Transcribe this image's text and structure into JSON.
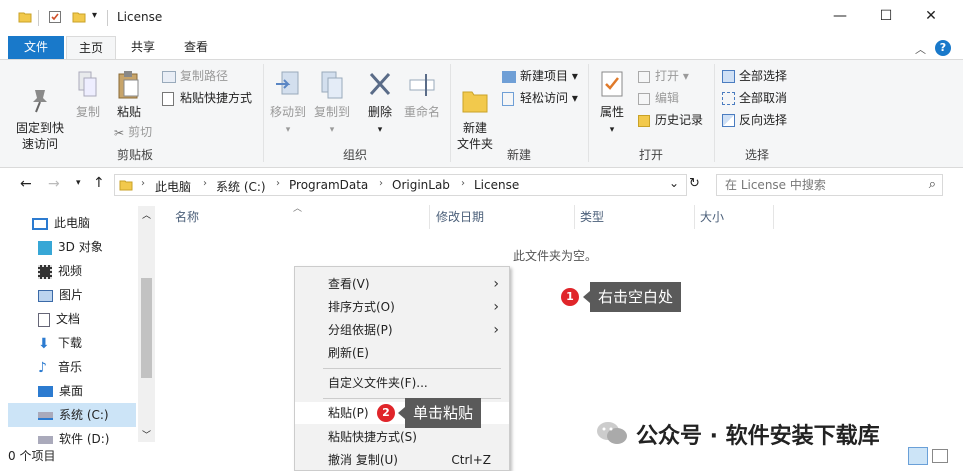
{
  "window": {
    "title": "License",
    "min": "—",
    "max": "☐",
    "close": "✕"
  },
  "tabs": {
    "file": "文件",
    "home": "主页",
    "share": "共享",
    "view": "查看"
  },
  "ribbon": {
    "pin": "固定到快\n速访问",
    "copy": "复制",
    "paste": "粘贴",
    "copy_path": "复制路径",
    "paste_shortcut": "粘贴快捷方式",
    "cut": "剪切",
    "clipboard_group": "剪贴板",
    "move_to": "移动到",
    "copy_to": "复制到",
    "delete": "删除",
    "rename": "重命名",
    "organize_group": "组织",
    "new_folder": "新建\n文件夹",
    "new_item": "新建项目",
    "easy_access": "轻松访问",
    "new_group": "新建",
    "properties": "属性",
    "open": "打开",
    "edit": "编辑",
    "history": "历史记录",
    "open_group": "打开",
    "select_all": "全部选择",
    "select_none": "全部取消",
    "invert_selection": "反向选择",
    "select_group": "选择"
  },
  "address": {
    "crumbs": [
      "此电脑",
      "系统 (C:)",
      "ProgramData",
      "OriginLab",
      "License"
    ],
    "search_placeholder": "在 License 中搜索"
  },
  "nav_pane": {
    "items": [
      "此电脑",
      "3D 对象",
      "视频",
      "图片",
      "文档",
      "下载",
      "音乐",
      "桌面",
      "系统 (C:)",
      "软件 (D:)"
    ]
  },
  "columns": {
    "name": "名称",
    "date": "修改日期",
    "type": "类型",
    "size": "大小"
  },
  "empty_message": "此文件夹为空。",
  "status": {
    "count": "0 个项目"
  },
  "context_menu": {
    "view": "查看(V)",
    "sort": "排序方式(O)",
    "group": "分组依据(P)",
    "refresh": "刷新(E)",
    "customize": "自定义文件夹(F)...",
    "paste": "粘贴(P)",
    "paste_shortcut": "粘贴快捷方式(S)",
    "undo": "撤消 复制(U)",
    "undo_shortcut": "Ctrl+Z"
  },
  "annotations": {
    "step1_num": "1",
    "step1_text": "右击空白处",
    "step2_num": "2",
    "step2_text": "单击粘贴"
  },
  "watermark": "公众号 · 软件安装下载库",
  "colors": {
    "accent": "#1979ca",
    "badge": "#e0252a",
    "callout": "#5a5a5a",
    "folder": "#f2c94c"
  }
}
